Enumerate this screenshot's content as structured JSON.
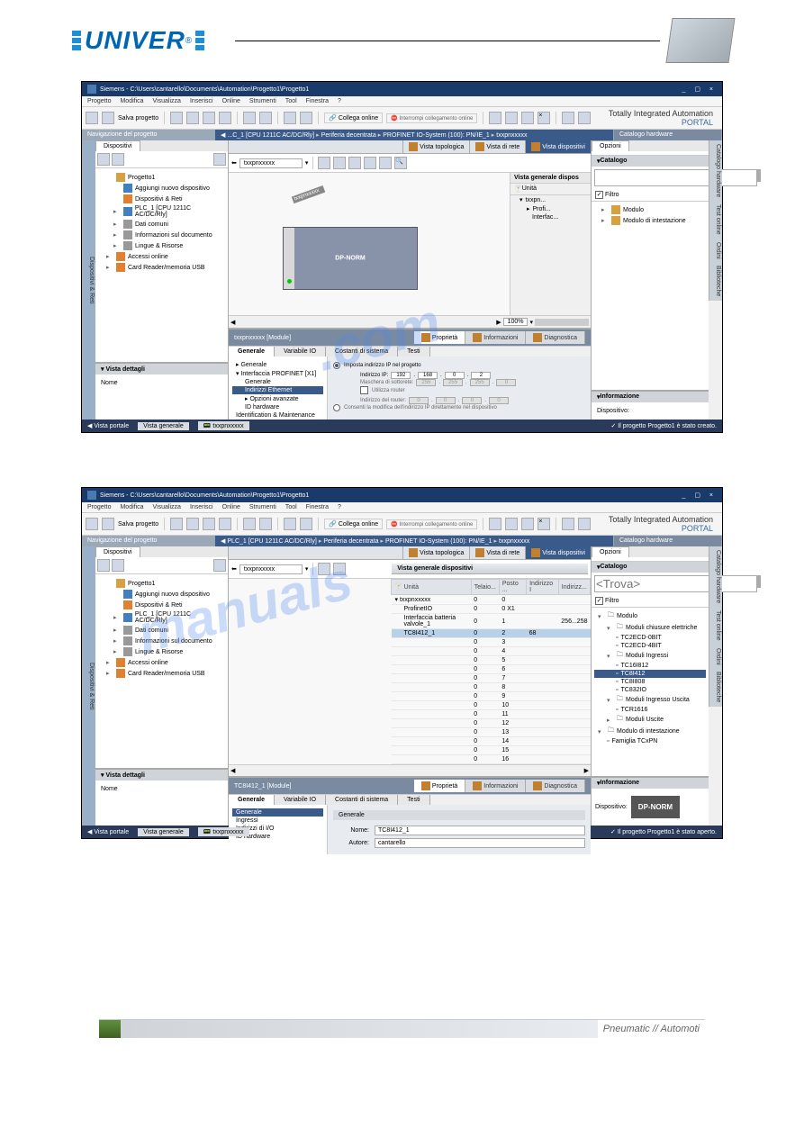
{
  "header": {
    "logo_text": "UNIVER",
    "reg": "®"
  },
  "screenshot1": {
    "title": "Siemens - C:\\Users\\cantarello\\Documents\\Automation\\Progetto1\\Progetto1",
    "menus": [
      "Progetto",
      "Modifica",
      "Visualizza",
      "Inserisci",
      "Online",
      "Strumenti",
      "Tool",
      "Finestra",
      "?"
    ],
    "toolbar": {
      "save": "Salva progetto",
      "collega": "Collega online",
      "interrompi": "Interrompi collegamento online"
    },
    "branding": {
      "line1": "Totally Integrated Automation",
      "line2": "PORTAL"
    },
    "nav_header": "Navigazione del progetto",
    "breadcrumb": [
      "...C_1 [CPU 1211C AC/DC/Rly]",
      "Periferia decentrata",
      "PROFINET IO-System (100): PN/IE_1",
      "txxpnxxxxx"
    ],
    "catalog_header": "Catalogo hardware",
    "left": {
      "tab": "Dispositivi",
      "tree": [
        {
          "label": "Progetto1",
          "icon": "folder",
          "lv": 0
        },
        {
          "label": "Aggiungi nuovo dispositivo",
          "icon": "blue",
          "lv": 1
        },
        {
          "label": "Dispositivi & Reti",
          "icon": "orange",
          "lv": 1
        },
        {
          "label": "PLC_1 [CPU 1211C AC/DC/Rly]",
          "icon": "blue",
          "lv": 1,
          "caret": "▸"
        },
        {
          "label": "Dati comuni",
          "icon": "grey",
          "lv": 1,
          "caret": "▸"
        },
        {
          "label": "Informazioni sul documento",
          "icon": "grey",
          "lv": 1,
          "caret": "▸"
        },
        {
          "label": "Lingue & Risorse",
          "icon": "grey",
          "lv": 1,
          "caret": "▸"
        },
        {
          "label": "Accessi online",
          "icon": "orange",
          "lv": 0,
          "caret": "▸"
        },
        {
          "label": "Card Reader/memoria USB",
          "icon": "orange",
          "lv": 0,
          "caret": "▸"
        }
      ],
      "details_header": "Vista dettagli",
      "details_col": "Nome"
    },
    "center": {
      "view_tabs": [
        {
          "label": "Vista topologica",
          "active": false
        },
        {
          "label": "Vista di rete",
          "active": false
        },
        {
          "label": "Vista dispositivi",
          "active": true
        }
      ],
      "sub_header": "Vista generale dispos",
      "device_select": "txxpnxxxxx",
      "plc_label": "txxpnxxxxx",
      "plc_norm": "DP-NORM",
      "grid_cols": [
        "...",
        "Unità"
      ],
      "grid_rows": [
        "txxpn...",
        "Profi...",
        "Interfac..."
      ],
      "zoom": "100%",
      "props_title": "txxpnxxxxx [Module]",
      "props_main_tabs": [
        {
          "label": "Proprietà",
          "icon": "gear",
          "active": true
        },
        {
          "label": "Informazioni",
          "icon": "info",
          "active": false
        },
        {
          "label": "Diagnostica",
          "icon": "diag",
          "active": false
        }
      ],
      "props_sub_tabs": [
        "Generale",
        "Variabile IO",
        "Costanti di sistema",
        "Testi"
      ],
      "props_nav": [
        {
          "label": "Generale",
          "lv": 0,
          "caret": "▸"
        },
        {
          "label": "Interfaccia PROFINET [X1]",
          "lv": 0,
          "caret": "▾"
        },
        {
          "label": "Generale",
          "lv": 1
        },
        {
          "label": "Indirizzi Ethernet",
          "lv": 1,
          "sel": true
        },
        {
          "label": "Opzioni avanzate",
          "lv": 1,
          "caret": "▸"
        },
        {
          "label": "ID hardware",
          "lv": 1
        },
        {
          "label": "Identification & Maintenance",
          "lv": 0
        }
      ],
      "form": {
        "radio1": "Imposta indirizzo IP nel progetto",
        "ip_label": "Indirizzo IP:",
        "ip": [
          "192",
          "168",
          "0",
          "2"
        ],
        "mask_label": "Maschera di sottorete:",
        "mask": [
          "255",
          "255",
          "255",
          "0"
        ],
        "router_chk": "Utilizza router",
        "router_label": "Indirizzo del router:",
        "router": [
          "0",
          "0",
          "0",
          "0"
        ],
        "radio2": "Consenti la modifica dell'indirizzo IP direttamente nel dispositivo"
      }
    },
    "right": {
      "tab": "Opzioni",
      "catalog_label": "Catalogo",
      "filter_label": "Filtro",
      "cat_tree": [
        {
          "label": "Modulo",
          "lv": 0,
          "caret": "▸"
        },
        {
          "label": "Modulo di intestazione",
          "lv": 0,
          "caret": "▸"
        }
      ],
      "info_header": "Informazione",
      "info_label": "Dispositivo:"
    },
    "side_tabs": [
      "Dispositivi & Reti",
      "Catalogo hardware",
      "Test online",
      "Ordini",
      "Biblioteche"
    ],
    "status": {
      "portal": "Vista portale",
      "general": "Vista generale",
      "device": "txxpnxxxxx",
      "msg": "Il progetto Progetto1 è stato creato."
    }
  },
  "screenshot2": {
    "title": "Siemens - C:\\Users\\cantarello\\Documents\\Automation\\Progetto1\\Progetto1",
    "breadcrumb": [
      "PLC_1 [CPU 1211C AC/DC/Rly]",
      "Periferia decentrata",
      "PROFINET IO-System (100): PN/IE_1",
      "txxpnxxxxx"
    ],
    "center": {
      "dev_ov_header": "Vista generale dispositivi",
      "cols": [
        "Unità",
        "Telaio...",
        "Posto ...",
        "Indirizzo I",
        "Indirizz..."
      ],
      "rows": [
        {
          "label": "txxpnxxxxx",
          "t": "0",
          "p": "0",
          "i": "",
          "o": "",
          "lv": 0
        },
        {
          "label": "ProfinetIO",
          "t": "0",
          "p": "0 X1",
          "i": "",
          "o": "",
          "lv": 1
        },
        {
          "label": "Interfaccia batteria valvole_1",
          "t": "0",
          "p": "1",
          "i": "",
          "o": "256...258",
          "lv": 1
        },
        {
          "label": "TC8I412_1",
          "t": "0",
          "p": "2",
          "i": "68",
          "o": "",
          "lv": 1,
          "sel": true
        },
        {
          "label": "",
          "t": "0",
          "p": "3",
          "lv": 1
        },
        {
          "label": "",
          "t": "0",
          "p": "4",
          "lv": 1
        },
        {
          "label": "",
          "t": "0",
          "p": "5",
          "lv": 1
        },
        {
          "label": "",
          "t": "0",
          "p": "6",
          "lv": 1
        },
        {
          "label": "",
          "t": "0",
          "p": "7",
          "lv": 1
        },
        {
          "label": "",
          "t": "0",
          "p": "8",
          "lv": 1
        },
        {
          "label": "",
          "t": "0",
          "p": "9",
          "lv": 1
        },
        {
          "label": "",
          "t": "0",
          "p": "10",
          "lv": 1
        },
        {
          "label": "",
          "t": "0",
          "p": "11",
          "lv": 1
        },
        {
          "label": "",
          "t": "0",
          "p": "12",
          "lv": 1
        },
        {
          "label": "",
          "t": "0",
          "p": "13",
          "lv": 1
        },
        {
          "label": "",
          "t": "0",
          "p": "14",
          "lv": 1
        },
        {
          "label": "",
          "t": "0",
          "p": "15",
          "lv": 1
        },
        {
          "label": "",
          "t": "0",
          "p": "16",
          "lv": 1
        }
      ],
      "props_title": "TC8I412_1 [Module]",
      "props_nav": [
        {
          "label": "Generale",
          "lv": 0,
          "sel": true
        },
        {
          "label": "Ingressi",
          "lv": 0
        },
        {
          "label": "Indirizzi di I/O",
          "lv": 0
        },
        {
          "label": "ID hardware",
          "lv": 0
        }
      ],
      "form": {
        "header": "Generale",
        "name_label": "Nome:",
        "name_val": "TC8I412_1",
        "author_label": "Autore:",
        "author_val": "cantarello"
      }
    },
    "right": {
      "search_placeholder": "<Trova>",
      "cat_tree": [
        {
          "label": "Modulo",
          "lv": 0,
          "caret": "▾",
          "icon": "folder"
        },
        {
          "label": "Moduli chiusure elettriche",
          "lv": 1,
          "caret": "▾",
          "icon": "folder"
        },
        {
          "label": "TC2ECD-0BIT",
          "lv": 2,
          "icon": "mod"
        },
        {
          "label": "TC2ECD-4BIT",
          "lv": 2,
          "icon": "mod"
        },
        {
          "label": "Moduli Ingressi",
          "lv": 1,
          "caret": "▾",
          "icon": "folder"
        },
        {
          "label": "TC16I812",
          "lv": 2,
          "icon": "mod"
        },
        {
          "label": "TC8I412",
          "lv": 2,
          "icon": "mod",
          "sel": true
        },
        {
          "label": "TC8I808",
          "lv": 2,
          "icon": "mod"
        },
        {
          "label": "TC832IO",
          "lv": 2,
          "icon": "mod"
        },
        {
          "label": "Moduli Ingresso Uscita",
          "lv": 1,
          "caret": "▾",
          "icon": "folder"
        },
        {
          "label": "TCR1616",
          "lv": 2,
          "icon": "mod"
        },
        {
          "label": "Moduli Uscite",
          "lv": 1,
          "caret": "▸",
          "icon": "folder"
        },
        {
          "label": "Modulo di intestazione",
          "lv": 0,
          "caret": "▾",
          "icon": "folder"
        },
        {
          "label": "Famiglia TCxPN",
          "lv": 1,
          "icon": "mod"
        }
      ],
      "dp_norm": "DP-NORM"
    },
    "status": {
      "msg": "Il progetto Progetto1 è stato aperto."
    }
  },
  "footer": {
    "text": "Pneumatic // Automoti"
  }
}
